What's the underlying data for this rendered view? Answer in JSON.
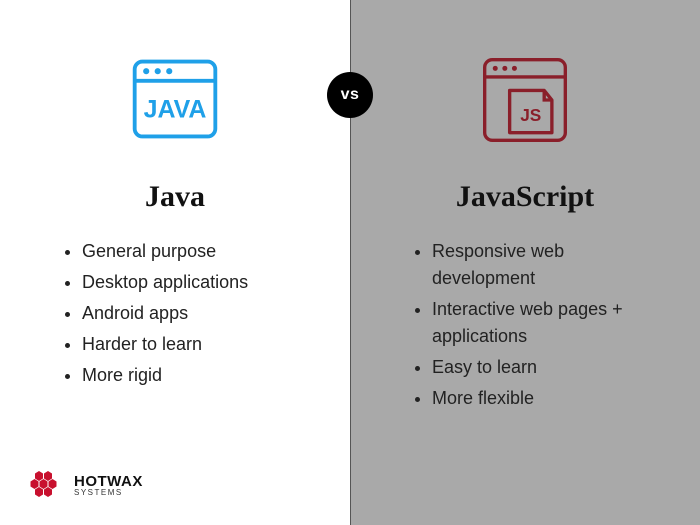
{
  "vs_label": "vs",
  "left": {
    "title": "Java",
    "icon_name": "java-browser-icon",
    "icon_color": "#1fa0e8",
    "icon_text": "JAVA",
    "bullets": [
      "General purpose",
      "Desktop applications",
      "Android apps",
      "Harder to learn",
      "More rigid"
    ]
  },
  "right": {
    "title": "JavaScript",
    "icon_name": "js-browser-icon",
    "icon_color": "#8a1f2a",
    "icon_text": "JS",
    "bullets": [
      "Responsive web development",
      "Interactive web pages + applications",
      "Easy to learn",
      "More flexible"
    ]
  },
  "logo": {
    "brand_top": "HOTWAX",
    "brand_bottom": "SYSTEMS",
    "hex_color": "#c8102e"
  }
}
